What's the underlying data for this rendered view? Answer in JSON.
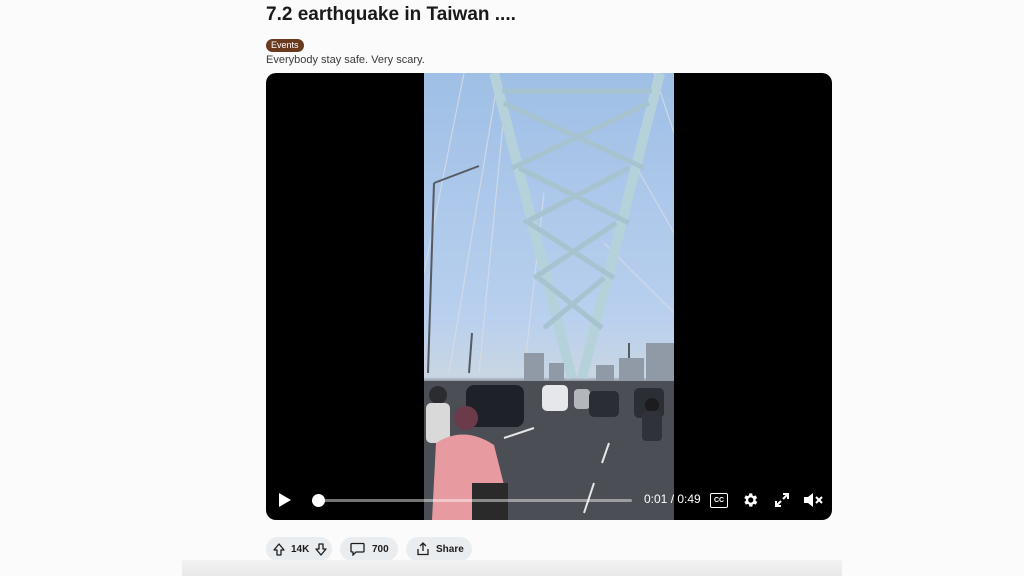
{
  "post": {
    "title": "7.2 earthquake in Taiwan ....",
    "flair": "Events",
    "body": "Everybody stay safe. Very scary.",
    "flair_color": "#6a3a1e"
  },
  "player": {
    "current_time": "0:01",
    "duration": "0:49",
    "timecode": "0:01 / 0:49",
    "progress": 0.02,
    "cc_label": "CC",
    "muted": true
  },
  "actions": {
    "votes": "14K",
    "comments": "700",
    "share": "Share"
  },
  "icons": [
    "play-icon",
    "cc-icon",
    "gear-icon",
    "expand-icon",
    "mute-icon",
    "upvote-icon",
    "downvote-icon",
    "comment-icon",
    "share-icon"
  ]
}
